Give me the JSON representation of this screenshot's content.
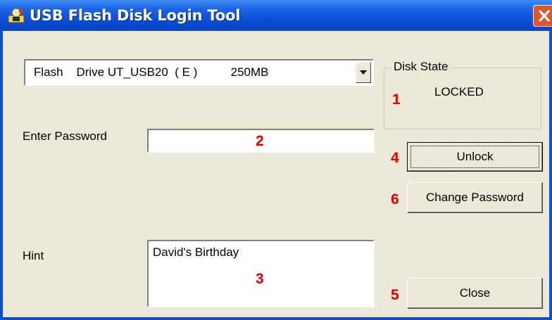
{
  "window": {
    "title": "USB Flash Disk Login Tool"
  },
  "drive_select": {
    "value": "Flash    Drive UT_USB20  ( E )          250MB"
  },
  "disk_state": {
    "group_title": "Disk State",
    "value": "LOCKED"
  },
  "password": {
    "label": "Enter Password",
    "value": ""
  },
  "hint": {
    "label": "Hint",
    "value": "David's Birthday"
  },
  "buttons": {
    "unlock": "Unlock",
    "change_password": "Change Password",
    "close": "Close"
  },
  "markers": {
    "m1": "1",
    "m2": "2",
    "m3": "3",
    "m4": "4",
    "m5": "5",
    "m6": "6"
  },
  "colors": {
    "title_bar": "#0a4ed4",
    "dialog_bg": "#ece9d8",
    "marker": "#e00000"
  }
}
